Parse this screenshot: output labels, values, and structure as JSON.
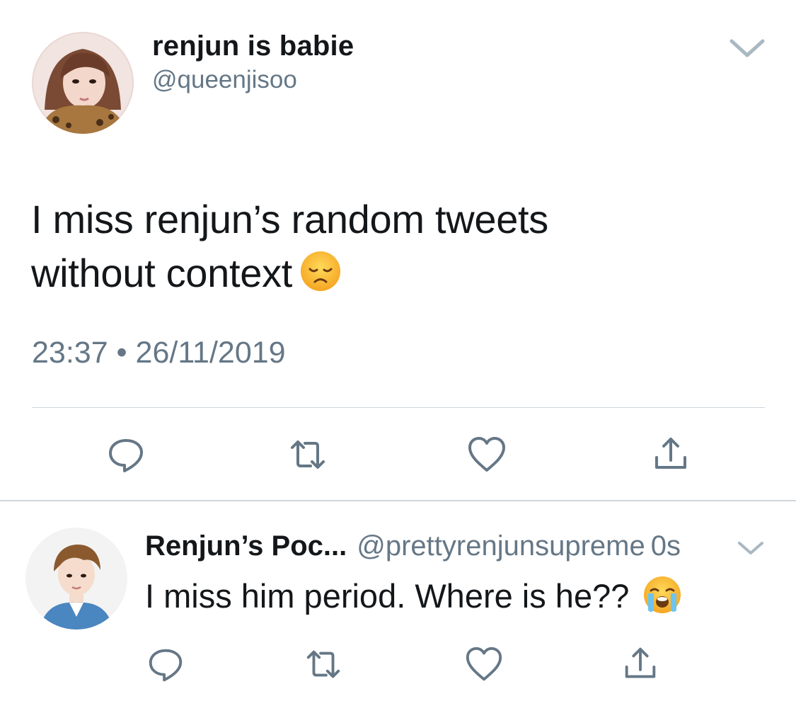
{
  "tweet": {
    "display_name": "renjun is babie",
    "handle": "@queenjisoo",
    "text_line1": "I miss renjun’s random tweets",
    "text_line2": "without context",
    "emoji": "disappointed-face",
    "timestamp": "23:37 • 26/11/2019"
  },
  "reply": {
    "display_name": "Renjun’s Poc...",
    "handle": "@prettyrenjunsupreme",
    "time": "0s",
    "text": "I miss him period. Where is he??",
    "emoji": "loudly-crying-face"
  },
  "colors": {
    "text": "#14171a",
    "secondary": "#657786",
    "icon": "#657786",
    "divider": "#cfd6dc"
  }
}
